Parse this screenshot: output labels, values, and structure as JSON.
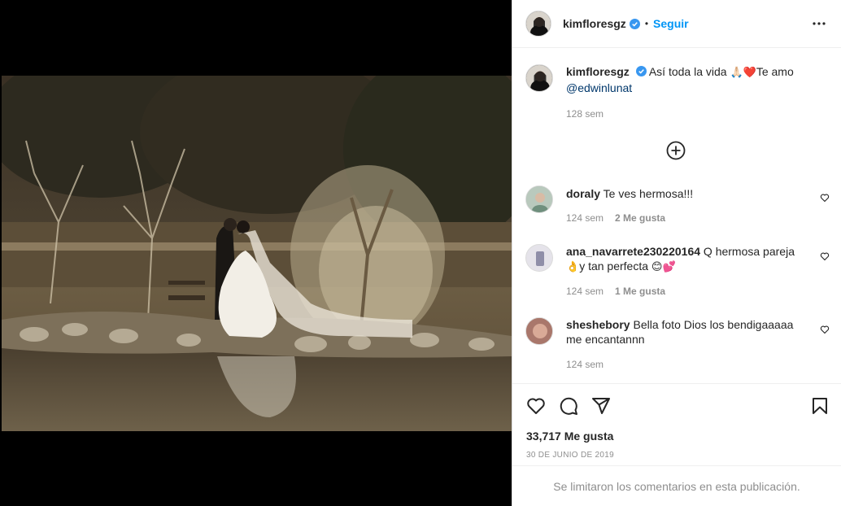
{
  "post": {
    "username": "kimfloresgz",
    "follow_label": "Seguir",
    "separator": "•",
    "caption_pre": "Así toda la vida ",
    "caption_emoji": "🙏🏻❤️",
    "caption_post": "Te amo",
    "mention": "@edwinlunat",
    "caption_time": "128 sem",
    "likes": "33,717 Me gusta",
    "date": "30 DE JUNIO DE 2019",
    "comments_limited": "Se limitaron los comentarios en esta publicación."
  },
  "comments": [
    {
      "user": "doraly",
      "text": "Te ves hermosa!!!",
      "time": "124 sem",
      "likes": "2 Me gusta"
    },
    {
      "user": "ana_navarrete230220164",
      "text_a": "Q hermosa pareja",
      "emoji_a": "👌",
      "text_b": "y tan perfecta ",
      "emoji_b": "😊💕",
      "time": "124 sem",
      "likes": "1 Me gusta"
    },
    {
      "user": "sheshebory",
      "text_a": "Bella foto Dios los bendigaaaaa",
      "text_b": "me encantannn",
      "time": "124 sem"
    }
  ],
  "icons": {
    "verified": "verified-badge-icon",
    "more": "more-options-icon",
    "add": "add-circle-icon",
    "like": "heart-icon",
    "comment": "comment-icon",
    "share": "send-icon",
    "save": "bookmark-icon"
  },
  "colors": {
    "accent": "#0095f6",
    "verified": "#3897f0",
    "muted": "#8e8e8e"
  }
}
